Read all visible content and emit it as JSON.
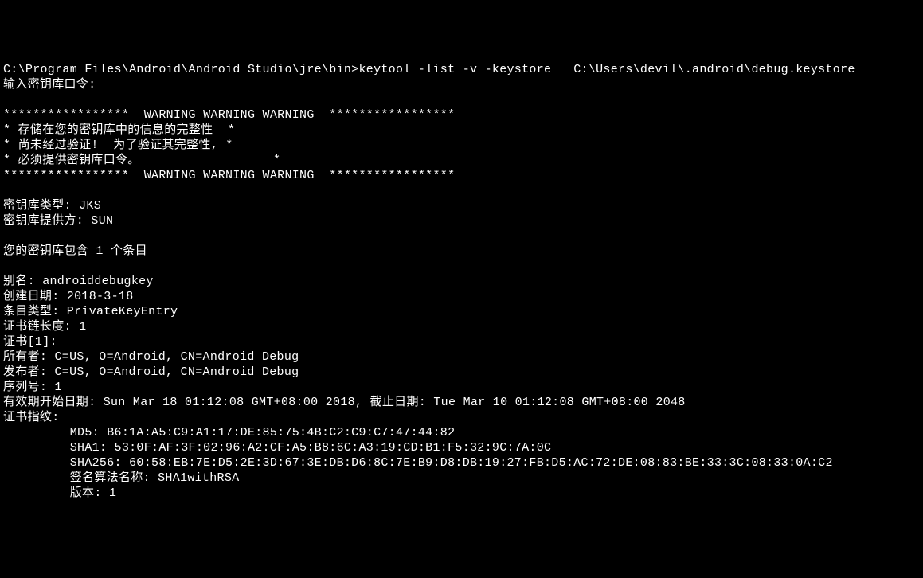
{
  "terminal": {
    "lines": [
      "C:\\Program Files\\Android\\Android Studio\\jre\\bin>keytool -list -v -keystore   C:\\Users\\devil\\.android\\debug.keystore",
      "输入密钥库口令:",
      "",
      "*****************  WARNING WARNING WARNING  *****************",
      "* 存储在您的密钥库中的信息的完整性  *",
      "* 尚未经过验证!  为了验证其完整性, *",
      "* 必须提供密钥库口令。                  *",
      "*****************  WARNING WARNING WARNING  *****************",
      "",
      "密钥库类型: JKS",
      "密钥库提供方: SUN",
      "",
      "您的密钥库包含 1 个条目",
      "",
      "别名: androiddebugkey",
      "创建日期: 2018-3-18",
      "条目类型: PrivateKeyEntry",
      "证书链长度: 1",
      "证书[1]:",
      "所有者: C=US, O=Android, CN=Android Debug",
      "发布者: C=US, O=Android, CN=Android Debug",
      "序列号: 1",
      "有效期开始日期: Sun Mar 18 01:12:08 GMT+08:00 2018, 截止日期: Tue Mar 10 01:12:08 GMT+08:00 2048",
      "证书指纹:",
      "         MD5: B6:1A:A5:C9:A1:17:DE:85:75:4B:C2:C9:C7:47:44:82",
      "         SHA1: 53:0F:AF:3F:02:96:A2:CF:A5:B8:6C:A3:19:CD:B1:F5:32:9C:7A:0C",
      "         SHA256: 60:58:EB:7E:D5:2E:3D:67:3E:DB:D6:8C:7E:B9:D8:DB:19:27:FB:D5:AC:72:DE:08:83:BE:33:3C:08:33:0A:C2",
      "         签名算法名称: SHA1withRSA",
      "         版本: 1"
    ]
  }
}
